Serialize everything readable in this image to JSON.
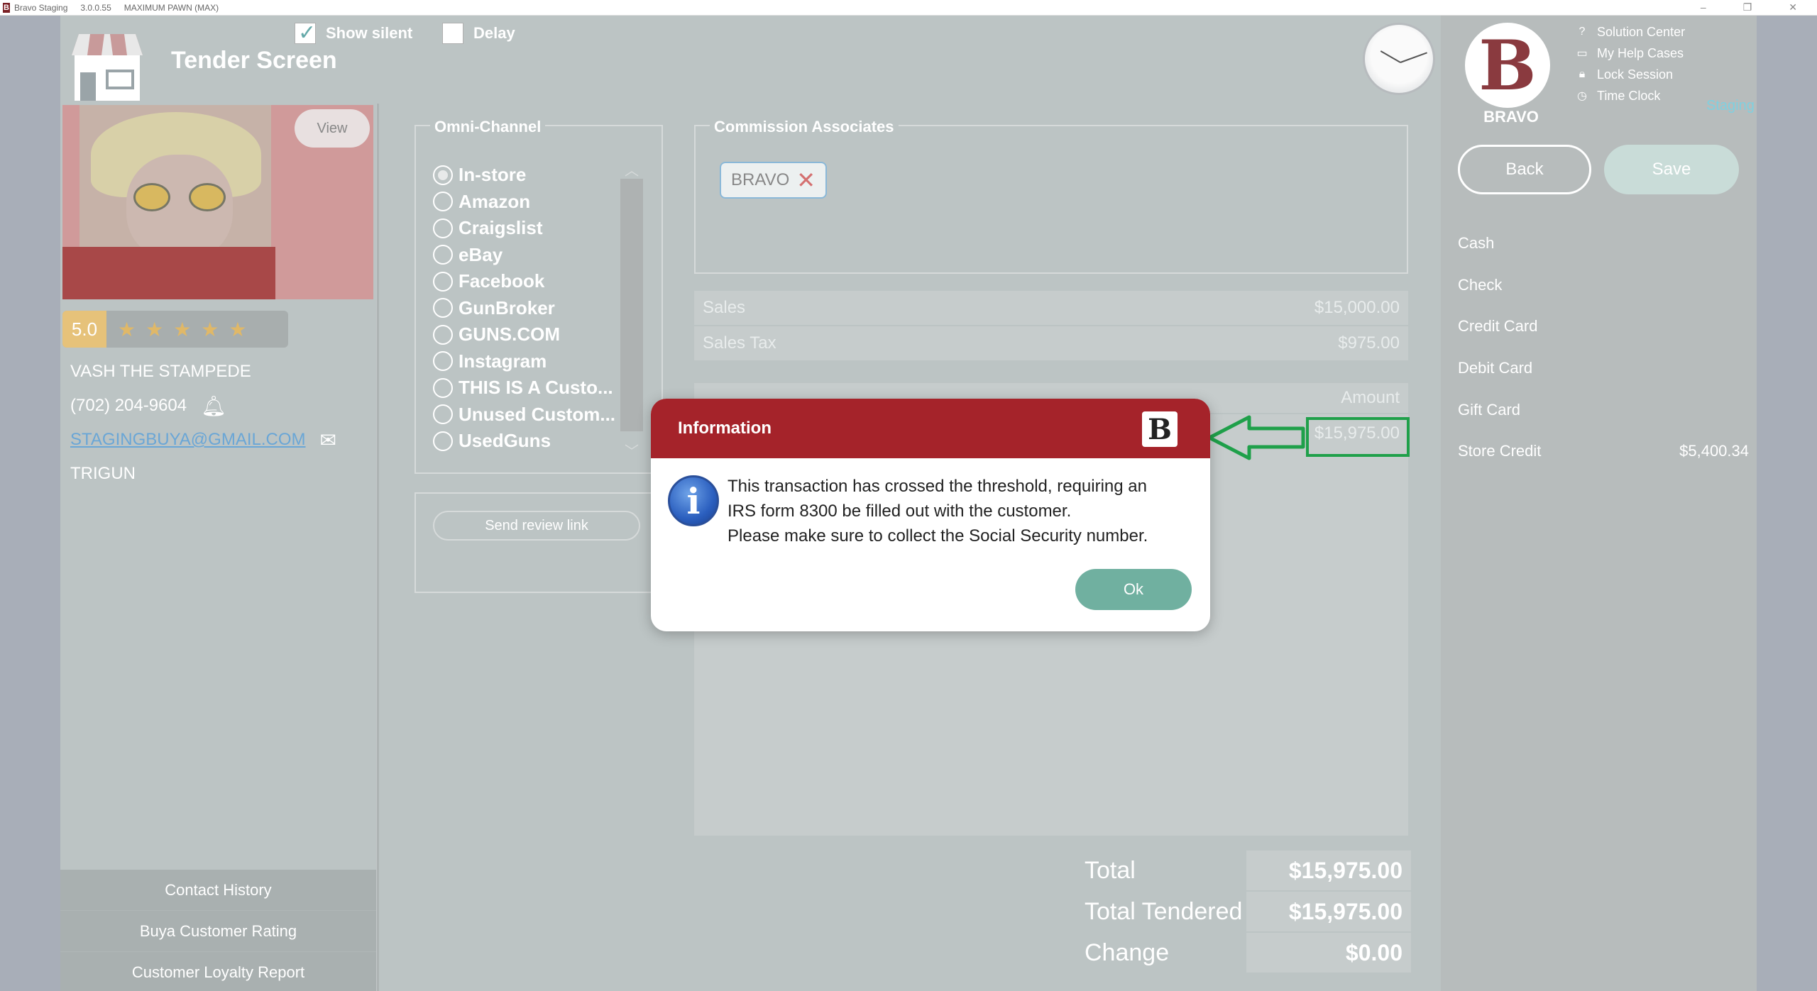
{
  "titlebar": {
    "app": "Bravo Staging",
    "version": "3.0.0.55",
    "store": "MAXIMUM PAWN (MAX)"
  },
  "header": {
    "title": "Tender Screen",
    "show_silent_label": "Show silent",
    "show_silent_checked": true,
    "delay_label": "Delay",
    "delay_checked": false
  },
  "brand": {
    "name": "BRAVO",
    "env": "Staging"
  },
  "help_links": {
    "solution_center": "Solution Center",
    "help_cases": "My Help Cases",
    "lock_session": "Lock Session",
    "time_clock": "Time Clock"
  },
  "actions": {
    "back": "Back",
    "save": "Save"
  },
  "tender_types": [
    {
      "label": "Cash",
      "value": ""
    },
    {
      "label": "Check",
      "value": ""
    },
    {
      "label": "Credit Card",
      "value": ""
    },
    {
      "label": "Debit Card",
      "value": ""
    },
    {
      "label": "Gift Card",
      "value": ""
    },
    {
      "label": "Store Credit",
      "value": "$5,400.34"
    }
  ],
  "customer": {
    "view_label": "View",
    "rating": "5.0",
    "stars": 5,
    "name": "VASH THE STAMPEDE",
    "phone": "(702) 204-9604",
    "email": "STAGINGBUYA@GMAIL.COM",
    "note": "TRIGUN",
    "links": [
      "Contact History",
      "Buya Customer Rating",
      "Customer Loyalty Report"
    ]
  },
  "omni_channel": {
    "legend": "Omni-Channel",
    "selected": "In-store",
    "options": [
      "In-store",
      "Amazon",
      "Craigslist",
      "eBay",
      "Facebook",
      "GunBroker",
      "GUNS.COM",
      "Instagram",
      "THIS IS A Custo...",
      "Unused Custom...",
      "UsedGuns"
    ],
    "review_link": "Send review link"
  },
  "commission": {
    "legend": "Commission Associates",
    "associate": "BRAVO"
  },
  "summary": {
    "sales_label": "Sales",
    "sales_value": "$15,000.00",
    "tax_label": "Sales Tax",
    "tax_value": "$975.00",
    "amount_header": "Amount",
    "amount_value": "$15,975.00"
  },
  "totals": {
    "total_label": "Total",
    "total_value": "$15,975.00",
    "tendered_label": "Total Tendered",
    "tendered_value": "$15,975.00",
    "change_label": "Change",
    "change_value": "$0.00"
  },
  "dialog": {
    "title": "Information",
    "line1": "This transaction has crossed the threshold, requiring an",
    "line2": "IRS form 8300 be filled out with the customer.",
    "line3": "Please make sure to collect the Social Security number.",
    "ok": "Ok"
  },
  "colors": {
    "dialog_header": "#a5232a",
    "ok_button": "#70b0a0",
    "highlight": "#1fa04a",
    "staging": "#7fd0e0"
  }
}
